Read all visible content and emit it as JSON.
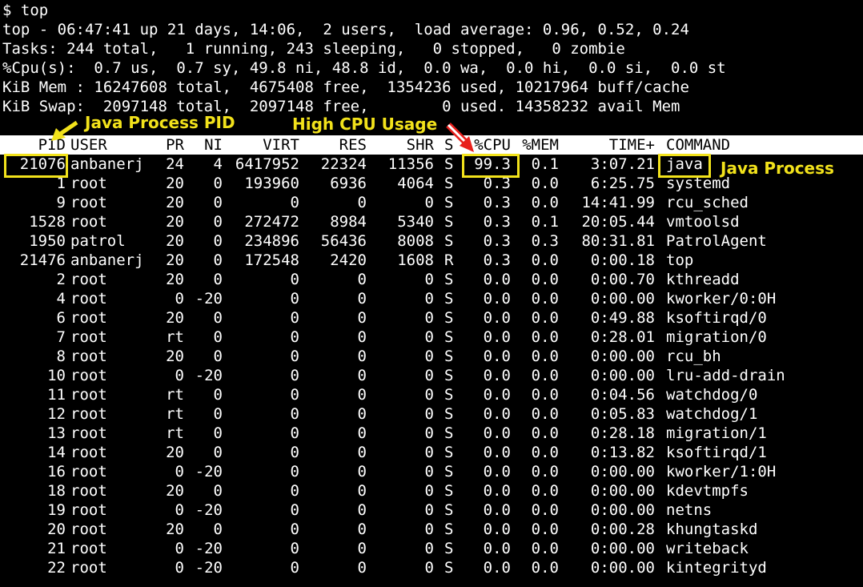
{
  "prompt": "$ top",
  "summary": {
    "uptime": "top - 06:47:41 up 21 days, 14:06,  2 users,  load average: 0.96, 0.52, 0.24",
    "tasks": "Tasks: 244 total,   1 running, 243 sleeping,   0 stopped,   0 zombie",
    "cpu": "%Cpu(s):  0.7 us,  0.7 sy, 49.8 ni, 48.8 id,  0.0 wa,  0.0 hi,  0.0 si,  0.0 st",
    "mem": "KiB Mem : 16247608 total,  4675408 free,  1354236 used, 10217964 buff/cache",
    "swap": "KiB Swap:  2097148 total,  2097148 free,        0 used. 14358232 avail Mem"
  },
  "columns": [
    "PID",
    "USER",
    "PR",
    "NI",
    "VIRT",
    "RES",
    "SHR",
    "S",
    "%CPU",
    "%MEM",
    "TIME+",
    "COMMAND"
  ],
  "processes": [
    [
      "21076",
      "anbanerj",
      "24",
      "4",
      "6417952",
      "22324",
      "11356",
      "S",
      "99.3",
      "0.1",
      "3:07.21",
      "java"
    ],
    [
      "1",
      "root",
      "20",
      "0",
      "193960",
      "6936",
      "4064",
      "S",
      "0.3",
      "0.0",
      "6:25.75",
      "systemd"
    ],
    [
      "9",
      "root",
      "20",
      "0",
      "0",
      "0",
      "0",
      "S",
      "0.3",
      "0.0",
      "14:41.99",
      "rcu_sched"
    ],
    [
      "1528",
      "root",
      "20",
      "0",
      "272472",
      "8984",
      "5340",
      "S",
      "0.3",
      "0.1",
      "20:05.44",
      "vmtoolsd"
    ],
    [
      "1950",
      "patrol",
      "20",
      "0",
      "234896",
      "56436",
      "8008",
      "S",
      "0.3",
      "0.3",
      "80:31.81",
      "PatrolAgent"
    ],
    [
      "21476",
      "anbanerj",
      "20",
      "0",
      "172548",
      "2420",
      "1608",
      "R",
      "0.3",
      "0.0",
      "0:00.18",
      "top"
    ],
    [
      "2",
      "root",
      "20",
      "0",
      "0",
      "0",
      "0",
      "S",
      "0.0",
      "0.0",
      "0:00.70",
      "kthreadd"
    ],
    [
      "4",
      "root",
      "0",
      "-20",
      "0",
      "0",
      "0",
      "S",
      "0.0",
      "0.0",
      "0:00.00",
      "kworker/0:0H"
    ],
    [
      "6",
      "root",
      "20",
      "0",
      "0",
      "0",
      "0",
      "S",
      "0.0",
      "0.0",
      "0:49.88",
      "ksoftirqd/0"
    ],
    [
      "7",
      "root",
      "rt",
      "0",
      "0",
      "0",
      "0",
      "S",
      "0.0",
      "0.0",
      "0:28.01",
      "migration/0"
    ],
    [
      "8",
      "root",
      "20",
      "0",
      "0",
      "0",
      "0",
      "S",
      "0.0",
      "0.0",
      "0:00.00",
      "rcu_bh"
    ],
    [
      "10",
      "root",
      "0",
      "-20",
      "0",
      "0",
      "0",
      "S",
      "0.0",
      "0.0",
      "0:00.00",
      "lru-add-drain"
    ],
    [
      "11",
      "root",
      "rt",
      "0",
      "0",
      "0",
      "0",
      "S",
      "0.0",
      "0.0",
      "0:04.56",
      "watchdog/0"
    ],
    [
      "12",
      "root",
      "rt",
      "0",
      "0",
      "0",
      "0",
      "S",
      "0.0",
      "0.0",
      "0:05.83",
      "watchdog/1"
    ],
    [
      "13",
      "root",
      "rt",
      "0",
      "0",
      "0",
      "0",
      "S",
      "0.0",
      "0.0",
      "0:28.18",
      "migration/1"
    ],
    [
      "14",
      "root",
      "20",
      "0",
      "0",
      "0",
      "0",
      "S",
      "0.0",
      "0.0",
      "0:13.82",
      "ksoftirqd/1"
    ],
    [
      "16",
      "root",
      "0",
      "-20",
      "0",
      "0",
      "0",
      "S",
      "0.0",
      "0.0",
      "0:00.00",
      "kworker/1:0H"
    ],
    [
      "18",
      "root",
      "20",
      "0",
      "0",
      "0",
      "0",
      "S",
      "0.0",
      "0.0",
      "0:00.00",
      "kdevtmpfs"
    ],
    [
      "19",
      "root",
      "0",
      "-20",
      "0",
      "0",
      "0",
      "S",
      "0.0",
      "0.0",
      "0:00.00",
      "netns"
    ],
    [
      "20",
      "root",
      "20",
      "0",
      "0",
      "0",
      "0",
      "S",
      "0.0",
      "0.0",
      "0:00.28",
      "khungtaskd"
    ],
    [
      "21",
      "root",
      "0",
      "-20",
      "0",
      "0",
      "0",
      "S",
      "0.0",
      "0.0",
      "0:00.00",
      "writeback"
    ],
    [
      "22",
      "root",
      "0",
      "-20",
      "0",
      "0",
      "0",
      "S",
      "0.0",
      "0.0",
      "0:00.00",
      "kintegrityd"
    ]
  ],
  "annotations": {
    "pid_label": "Java Process PID",
    "cpu_label": "High CPU Usage",
    "command_label": "Java Process",
    "highlight_color": "#f2e21b",
    "arrow_color": "#e8201c"
  }
}
